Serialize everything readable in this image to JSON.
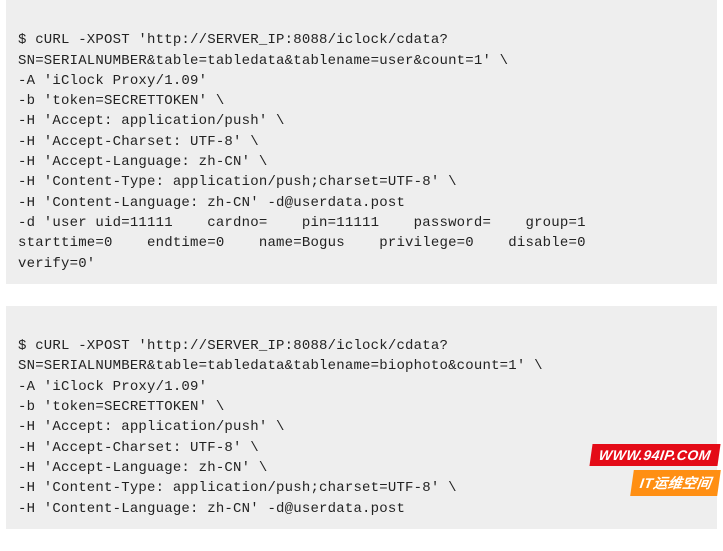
{
  "blocks": [
    {
      "lines": [
        "$ cURL -XPOST 'http://SERVER_IP:8088/iclock/cdata?SN=SERIALNUMBER&table=tabledata&tablename=user&count=1' \\",
        "-A 'iClock Proxy/1.09'",
        "-b 'token=SECRETTOKEN' \\",
        "-H 'Accept: application/push' \\",
        "-H 'Accept-Charset: UTF-8' \\",
        "-H 'Accept-Language: zh-CN' \\",
        "-H 'Content-Type: application/push;charset=UTF-8' \\",
        "-H 'Content-Language: zh-CN' -d@userdata.post"
      ],
      "justified_lines": [
        "-d 'user uid=11111    cardno=    pin=11111    password=    group=1",
        "starttime=0    endtime=0    name=Bogus    privilege=0    disable=0"
      ],
      "tail": "verify=0'"
    },
    {
      "lines": [
        "$ cURL -XPOST 'http://SERVER_IP:8088/iclock/cdata?SN=SERIALNUMBER&table=tabledata&tablename=biophoto&count=1' \\",
        "-A 'iClock Proxy/1.09'",
        "-b 'token=SECRETTOKEN' \\",
        "-H 'Accept: application/push' \\",
        "-H 'Accept-Charset: UTF-8' \\",
        "-H 'Accept-Language: zh-CN' \\",
        "-H 'Content-Type: application/push;charset=UTF-8' \\",
        "-H 'Content-Language: zh-CN' -d@userdata.post"
      ],
      "justified_lines": [],
      "tail": ""
    }
  ],
  "overlay": {
    "badge1": "WWW.94IP.COM",
    "badge2": "IT运维空间"
  }
}
